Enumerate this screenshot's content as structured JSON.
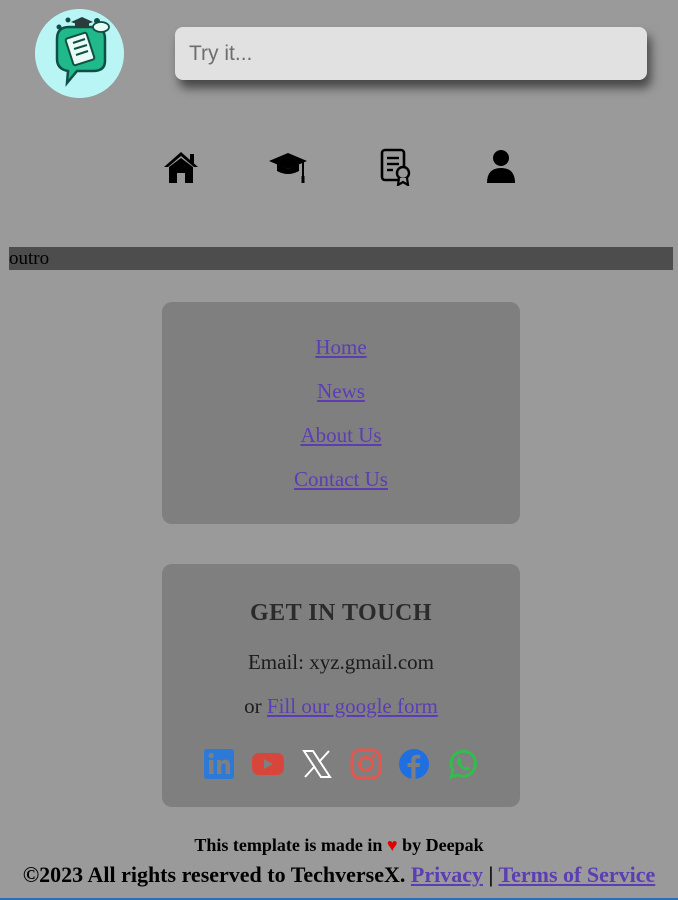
{
  "header": {
    "logo_icon": "chat-bubble-checklist-logo",
    "search_placeholder": "Try it..."
  },
  "nav": {
    "items": [
      {
        "icon": "home-icon"
      },
      {
        "icon": "graduation-cap-icon"
      },
      {
        "icon": "certificate-icon"
      },
      {
        "icon": "user-icon"
      }
    ]
  },
  "outro_label": "outro",
  "footer_links": [
    "Home",
    "News",
    "About Us",
    "Contact Us"
  ],
  "contact": {
    "heading": "GET IN TOUCH",
    "email_line": "Email: xyz.gmail.com",
    "form_prefix": "or",
    "form_link": "Fill our google form",
    "social": [
      {
        "icon": "linkedin-icon",
        "color": "#2c7ad6"
      },
      {
        "icon": "youtube-icon",
        "color": "#d8453a"
      },
      {
        "icon": "x-icon",
        "color": "#ffffff"
      },
      {
        "icon": "instagram-icon",
        "color": "#e0584f"
      },
      {
        "icon": "facebook-icon",
        "color": "#1f6fe0"
      },
      {
        "icon": "whatsapp-icon",
        "color": "#2fbf4a"
      }
    ]
  },
  "credit": {
    "prefix": "This template is made in",
    "heart": "♥",
    "suffix": "by Deepak"
  },
  "copyright": {
    "text": "©2023 All rights reserved to TechverseX.",
    "privacy": "Privacy",
    "separator": "|",
    "terms": "Terms of Service"
  },
  "colors": {
    "background": "#9a9a9a",
    "card": "#7f7f7f",
    "link": "#5c3db4",
    "outro_bar": "#4d4d4d"
  }
}
